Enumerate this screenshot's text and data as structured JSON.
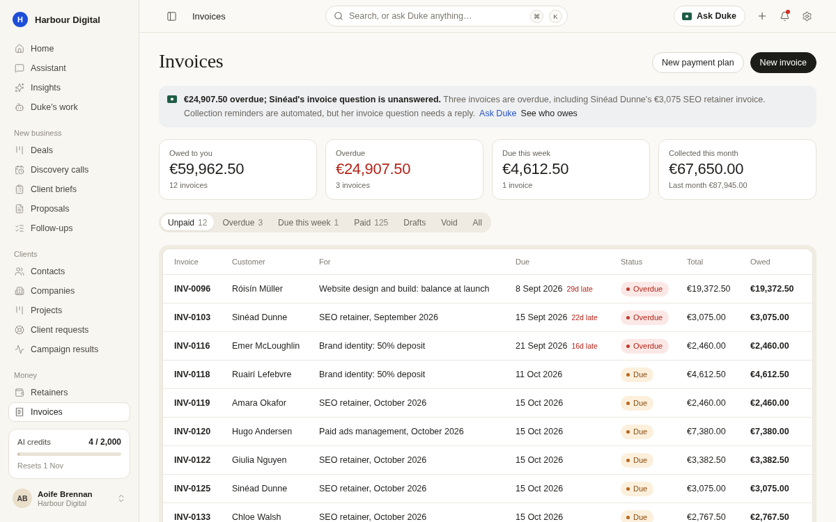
{
  "sidebar": {
    "workspace": {
      "logo_letter": "H",
      "name": "Harbour Digital"
    },
    "sections": [
      {
        "items": [
          {
            "label": "Home",
            "selected": false
          },
          {
            "label": "Assistant",
            "selected": false
          },
          {
            "label": "Insights",
            "selected": false
          },
          {
            "label": "Duke's work",
            "selected": false
          }
        ]
      },
      {
        "title": "New business",
        "items": [
          {
            "label": "Deals",
            "selected": false
          },
          {
            "label": "Discovery calls",
            "selected": false
          },
          {
            "label": "Client briefs",
            "selected": false
          },
          {
            "label": "Proposals",
            "selected": false
          },
          {
            "label": "Follow-ups",
            "selected": false
          }
        ]
      },
      {
        "title": "Clients",
        "items": [
          {
            "label": "Contacts",
            "selected": false
          },
          {
            "label": "Companies",
            "selected": false
          },
          {
            "label": "Projects",
            "selected": false
          },
          {
            "label": "Client requests",
            "selected": false
          },
          {
            "label": "Campaign results",
            "selected": false
          }
        ]
      },
      {
        "title": "Money",
        "items": [
          {
            "label": "Retainers",
            "selected": false
          },
          {
            "label": "Invoices",
            "selected": true
          }
        ]
      }
    ],
    "credits": {
      "label": "AI credits",
      "value": "4 / 2,000",
      "level": 0.002,
      "note": "Resets 1 Nov"
    },
    "user": {
      "initials": "AB",
      "name": "Aoife Brennan",
      "org": "Harbour Digital"
    }
  },
  "topbar": {
    "breadcrumb": "Invoices",
    "search": {
      "placeholder": "Search, or ask Duke anything…",
      "shortcut": [
        "⌘",
        "K"
      ]
    },
    "ask_button": "Ask Duke",
    "notifications": {
      "unread": true
    }
  },
  "page": {
    "title": "Invoices",
    "buttons": [
      {
        "label": "New payment plan",
        "kind": "secondary"
      },
      {
        "label": "New invoice",
        "kind": "primary"
      }
    ]
  },
  "banner": {
    "message": "**€24,907.50 overdue; Sinéad's invoice question is unanswered.** Three invoices are overdue, including Sinéad Dunne's €3,075 SEO retainer invoice. Collection reminders are automated, but her invoice question needs a reply.",
    "links": [
      {
        "label": "Ask Duke",
        "kind": "accent"
      },
      {
        "label": "See who owes",
        "kind": "plain"
      }
    ]
  },
  "stats": [
    {
      "label": "Owed to you",
      "value": "€59,962.50",
      "note": "12 invoices",
      "alert": false
    },
    {
      "label": "Overdue",
      "value": "€24,907.50",
      "note": "3 invoices",
      "alert": true
    },
    {
      "label": "Due this week",
      "value": "€4,612.50",
      "note": "1 invoice",
      "alert": false
    },
    {
      "label": "Collected this month",
      "value": "€67,650.00",
      "note": "Last month €87,945.00",
      "alert": false
    }
  ],
  "filters": [
    {
      "label": "Unpaid",
      "count": "12",
      "selected": true
    },
    {
      "label": "Overdue",
      "count": "3",
      "selected": false
    },
    {
      "label": "Due this week",
      "count": "1",
      "selected": false
    },
    {
      "label": "Paid",
      "count": "125",
      "selected": false
    },
    {
      "label": "Drafts",
      "selected": false
    },
    {
      "label": "Void",
      "selected": false
    },
    {
      "label": "All",
      "selected": false
    }
  ],
  "table": {
    "columns": [
      "Invoice",
      "Customer",
      "For",
      "Due",
      "Status",
      "Total",
      "Owed"
    ],
    "rows": [
      {
        "invoice": "INV-0096",
        "customer": "Róisín Müller",
        "for": "Website design and build: balance at launch",
        "due": "8 Sept 2026",
        "late": "29d late",
        "status": {
          "label": "Overdue",
          "kind": "overdue"
        },
        "total": "€19,372.50",
        "owed": "€19,372.50"
      },
      {
        "invoice": "INV-0103",
        "customer": "Sinéad Dunne",
        "for": "SEO retainer, September 2026",
        "due": "15 Sept 2026",
        "late": "22d late",
        "status": {
          "label": "Overdue",
          "kind": "overdue"
        },
        "total": "€3,075.00",
        "owed": "€3,075.00"
      },
      {
        "invoice": "INV-0116",
        "customer": "Emer McLoughlin",
        "for": "Brand identity: 50% deposit",
        "due": "21 Sept 2026",
        "late": "16d late",
        "status": {
          "label": "Overdue",
          "kind": "overdue"
        },
        "total": "€2,460.00",
        "owed": "€2,460.00"
      },
      {
        "invoice": "INV-0118",
        "customer": "Ruairí Lefebvre",
        "for": "Brand identity: 50% deposit",
        "due": "11 Oct 2026",
        "status": {
          "label": "Due",
          "kind": "due"
        },
        "total": "€4,612.50",
        "owed": "€4,612.50"
      },
      {
        "invoice": "INV-0119",
        "customer": "Amara Okafor",
        "for": "SEO retainer, October 2026",
        "due": "15 Oct 2026",
        "status": {
          "label": "Due",
          "kind": "due"
        },
        "total": "€2,460.00",
        "owed": "€2,460.00"
      },
      {
        "invoice": "INV-0120",
        "customer": "Hugo Andersen",
        "for": "Paid ads management, October 2026",
        "due": "15 Oct 2026",
        "status": {
          "label": "Due",
          "kind": "due"
        },
        "total": "€7,380.00",
        "owed": "€7,380.00"
      },
      {
        "invoice": "INV-0122",
        "customer": "Giulia Nguyen",
        "for": "SEO retainer, October 2026",
        "due": "15 Oct 2026",
        "status": {
          "label": "Due",
          "kind": "due"
        },
        "total": "€3,382.50",
        "owed": "€3,382.50"
      },
      {
        "invoice": "INV-0125",
        "customer": "Sinéad Dunne",
        "for": "SEO retainer, October 2026",
        "due": "15 Oct 2026",
        "status": {
          "label": "Due",
          "kind": "due"
        },
        "total": "€3,075.00",
        "owed": "€3,075.00"
      },
      {
        "invoice": "INV-0133",
        "customer": "Chloe Walsh",
        "for": "SEO retainer, October 2026",
        "due": "15 Oct 2026",
        "status": {
          "label": "Due",
          "kind": "due"
        },
        "total": "€2,767.50",
        "owed": "€2,767.50"
      }
    ]
  }
}
